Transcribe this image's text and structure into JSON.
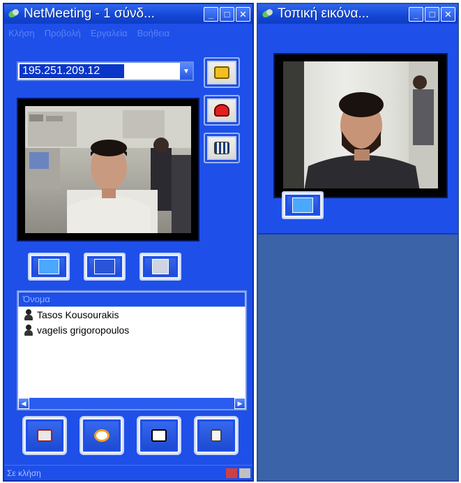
{
  "main_window": {
    "title": "NetMeeting - 1 σύνδ...",
    "menu": [
      "Κλήση",
      "Προβολή",
      "Εργαλεία",
      "Βοήθεια"
    ],
    "address_value": "195.251.209.12",
    "list_header": "Όνομα",
    "participants": [
      "Tasos Kousourakis",
      "vagelis grigoropoulos"
    ],
    "status": "Σε κλήση"
  },
  "local_window": {
    "title": "Τοπική εικόνα..."
  },
  "icons": {
    "app": "netmeeting-icon",
    "call": "phone-call-icon",
    "hangup": "hang-up-icon",
    "directory": "address-book-icon",
    "play_pause": "play-pause-icon",
    "picture_in_picture": "picture-in-picture-icon",
    "audio": "audio-volume-icon",
    "share": "share-program-icon",
    "chat": "chat-icon",
    "whiteboard": "whiteboard-icon",
    "file_transfer": "file-transfer-icon"
  },
  "colors": {
    "window_blue": "#1e4fe8",
    "title_gradient_top": "#2e66f0",
    "desktop_gray_blue": "#3a63a8"
  }
}
